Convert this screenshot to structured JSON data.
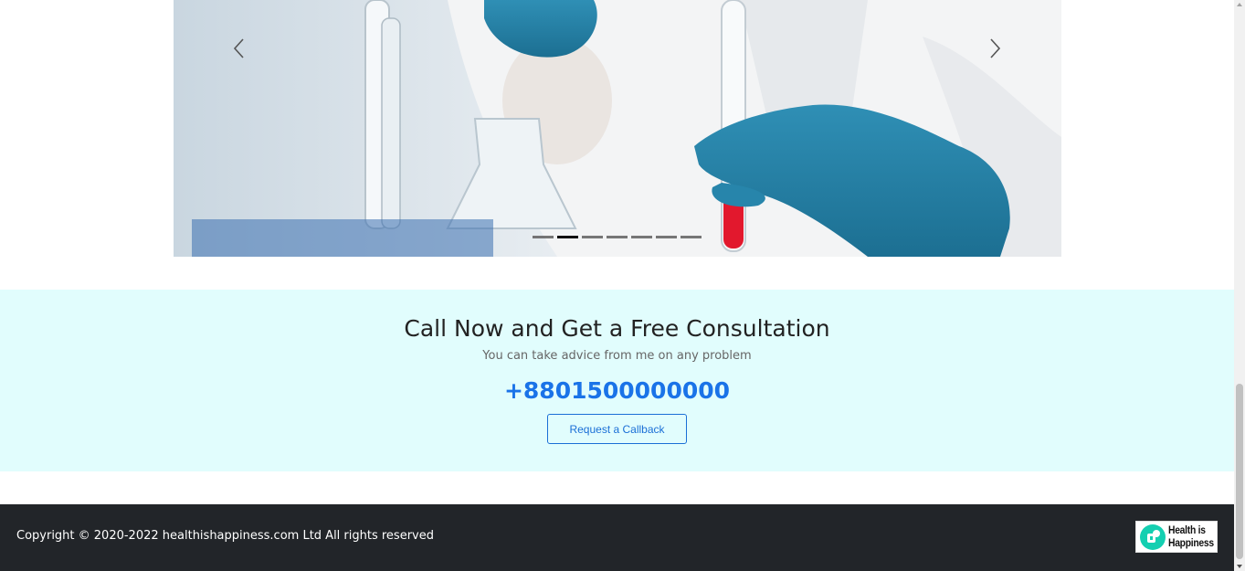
{
  "carousel": {
    "slide_count": 7,
    "active_index": 1,
    "prev_label": "Previous",
    "next_label": "Next"
  },
  "consultation": {
    "title": "Call Now and Get a Free Consultation",
    "subtitle": "You can take advice from me on any problem",
    "phone": "+8801500000000",
    "button_label": "Request a Callback"
  },
  "footer": {
    "copyright": "Copyright © 2020-2022 healthishappiness.com Ltd All rights reserved",
    "logo_text_line1": "Health is",
    "logo_text_line2": "Happiness"
  },
  "colors": {
    "consult_bg": "#e1fdfd",
    "phone": "#1a73e8",
    "footer_bg": "#222529",
    "logo_accent": "#14cfb1"
  }
}
